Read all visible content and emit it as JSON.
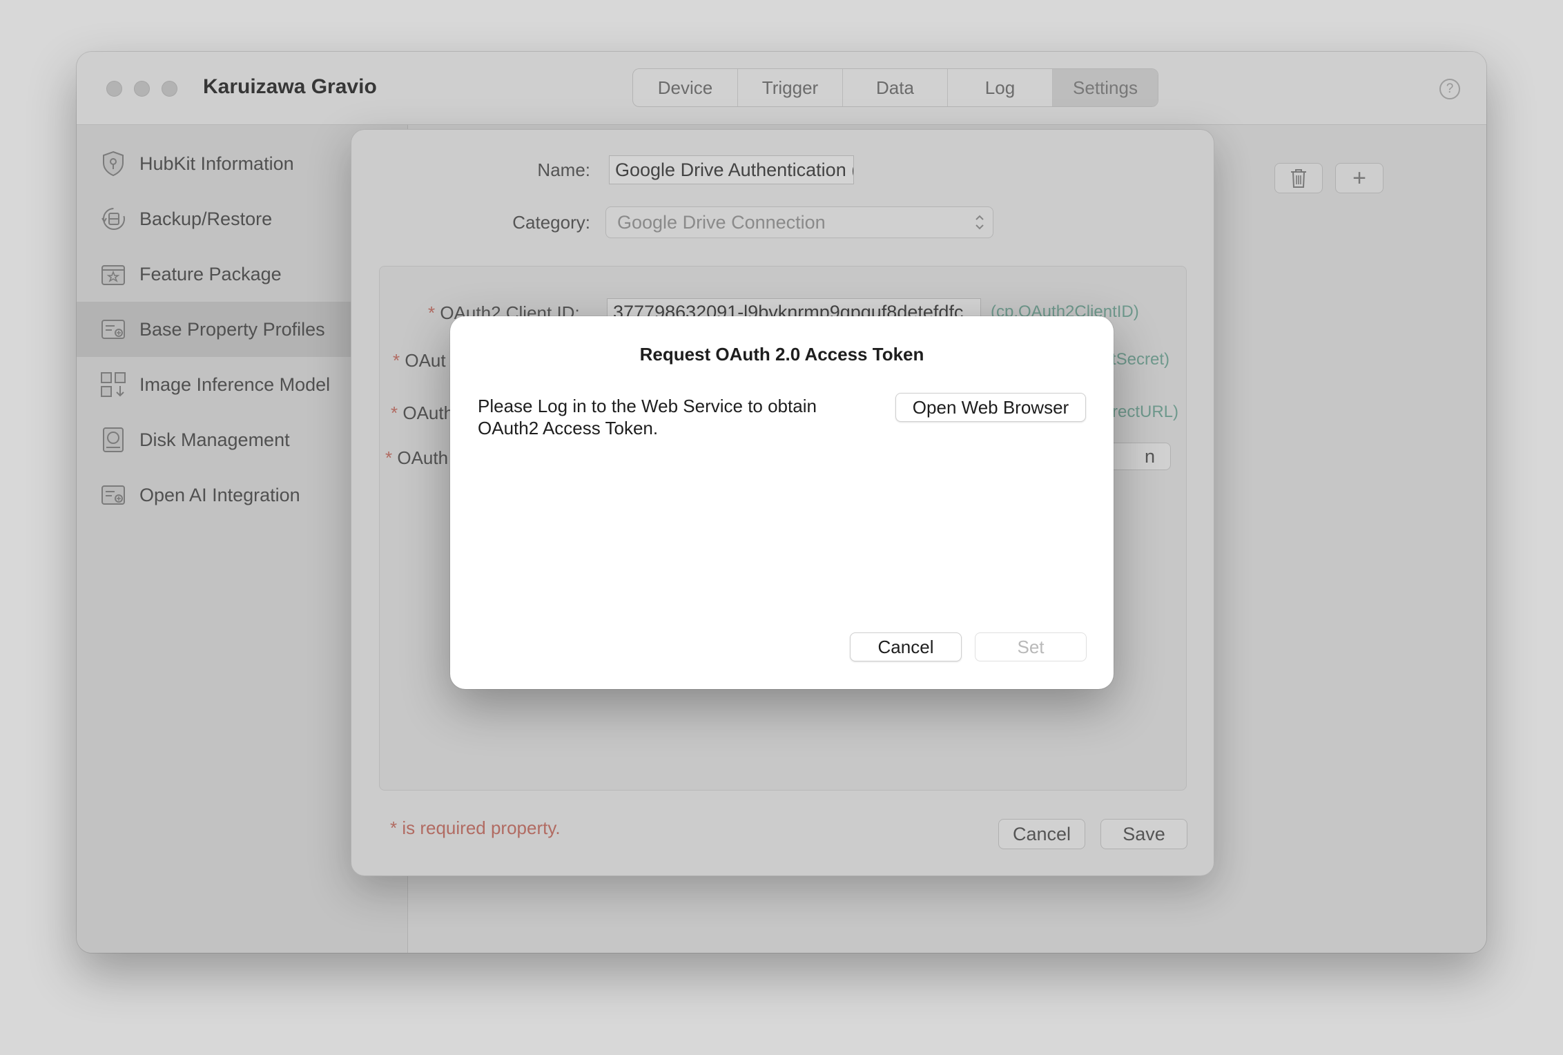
{
  "app": {
    "title": "Karuizawa Gravio"
  },
  "toolbar": {
    "tabs": [
      {
        "label": "Device"
      },
      {
        "label": "Trigger"
      },
      {
        "label": "Data"
      },
      {
        "label": "Log"
      },
      {
        "label": "Settings",
        "active": true
      }
    ],
    "help_glyph": "?"
  },
  "sidebar": {
    "items": [
      {
        "label": "HubKit Information",
        "icon": "shield-icon"
      },
      {
        "label": "Backup/Restore",
        "icon": "backup-icon"
      },
      {
        "label": "Feature Package",
        "icon": "star-package-icon"
      },
      {
        "label": "Base Property Profiles",
        "icon": "profile-card-icon",
        "selected": true
      },
      {
        "label": "Image Inference Model",
        "icon": "grid-download-icon"
      },
      {
        "label": "Disk Management",
        "icon": "disk-icon"
      },
      {
        "label": "Open AI Integration",
        "icon": "ai-card-icon"
      }
    ]
  },
  "content": {
    "delete_icon": "trash-icon",
    "add_glyph": "+"
  },
  "profile_sheet": {
    "name_label": "Name:",
    "name_value": "Google Drive Authentication (Christoph)",
    "category_label": "Category:",
    "category_value": "Google Drive Connection",
    "required_star": "*",
    "fields": [
      {
        "label": "OAuth2 Client ID:",
        "value": "377798632091-l9bvknrmp9qpquf8detefdfc",
        "hint": "(cp.OAuth2ClientID)"
      },
      {
        "label": "OAut",
        "hint": "tSecret)"
      },
      {
        "label": "OAuth",
        "hint": "rectURL)"
      },
      {
        "label": "OAuth",
        "button_fragment": "n"
      }
    ],
    "required_note": "* is required property.",
    "cancel_label": "Cancel",
    "save_label": "Save"
  },
  "modal": {
    "title": "Request OAuth 2.0 Access Token",
    "message": "Please Log in to the Web Service to obtain OAuth2 Access Token.",
    "open_browser_label": "Open Web Browser",
    "cancel_label": "Cancel",
    "set_label": "Set"
  },
  "colors": {
    "required_red": "#d07a6f",
    "hint_green": "#7fb3a4"
  }
}
